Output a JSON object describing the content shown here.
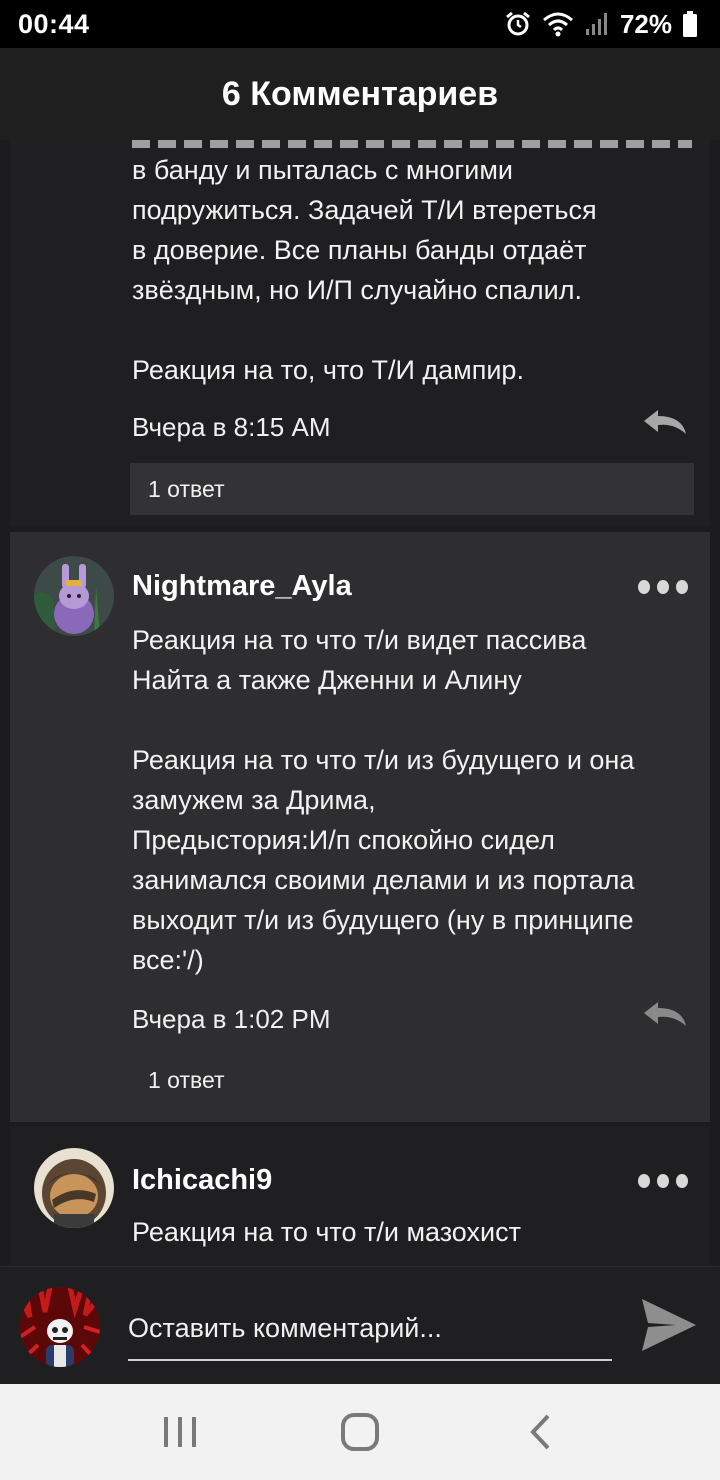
{
  "status_bar": {
    "time": "00:44",
    "battery": "72%",
    "icons": [
      "alarm-icon",
      "wifi-icon",
      "signal-icon",
      "battery-icon"
    ]
  },
  "header": {
    "title": "6 Комментариев"
  },
  "comments": [
    {
      "text": "в банду и пыталась с многими\nподружиться. Задачей Т/И втереться\nв доверие. Все планы банды отдаёт\nзвёздным, но И/П случайно спалил.\n\nРеакция на то, что Т/И дампир.",
      "time": "Вчера в 8:15 AM",
      "replies": "1 ответ"
    },
    {
      "author": "Nightmare_Ayla",
      "text": "Реакция на то что т/и видет пассива\nНайта а также Дженни и Алину\n\nРеакция на то что т/и из будущего и она\nзамужем за Дрима,\nПредыстория:И/п спокойно сидел\nзанимался своими делами и из портала\nвыходит т/и из будущего (ну в принципе\nвсе:'/)",
      "time": "Вчера в 1:02 PM",
      "replies": "1 ответ"
    },
    {
      "author": "Ichicachi9",
      "text": "Реакция на то что т/и мазохист"
    }
  ],
  "composer": {
    "placeholder": "Оставить комментарий..."
  },
  "colors": {
    "background": "#1c1c1e",
    "highlight": "#2e2e30",
    "replies_box": "#333335",
    "nav_bar": "#f2f2f2"
  }
}
